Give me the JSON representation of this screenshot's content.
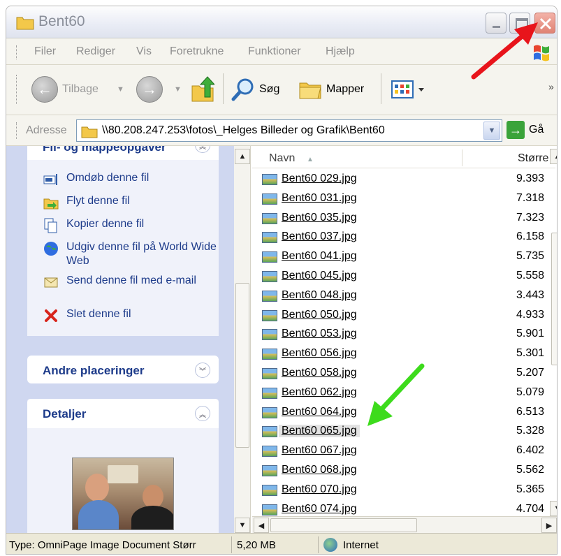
{
  "window": {
    "title": "Bent60"
  },
  "menu": {
    "items": [
      "Filer",
      "Rediger",
      "Vis",
      "Foretrukne",
      "Funktioner",
      "Hjælp"
    ]
  },
  "toolbar": {
    "back_label": "Tilbage",
    "search_label": "Søg",
    "folders_label": "Mapper",
    "more_glyph": "»"
  },
  "address": {
    "label": "Adresse",
    "value": "\\\\80.208.247.253\\fotos\\_Helges Billeder og Grafik\\Bent60",
    "go_label": "Gå"
  },
  "taskpane": {
    "tasks_title": "Fil- og mappeopgaver",
    "tasks": [
      {
        "icon": "rename-icon",
        "label": "Omdøb denne fil"
      },
      {
        "icon": "move-icon",
        "label": "Flyt denne fil"
      },
      {
        "icon": "copy-icon",
        "label": "Kopier denne fil"
      },
      {
        "icon": "publish-web-icon",
        "label": "Udgiv denne fil på World Wide Web"
      },
      {
        "icon": "email-icon",
        "label": "Send denne fil med e-mail"
      },
      {
        "icon": "delete-icon",
        "label": "Slet denne fil"
      }
    ],
    "places_title": "Andre placeringer",
    "details_title": "Detaljer"
  },
  "filelist": {
    "columns": {
      "name": "Navn",
      "size": "Større"
    },
    "files": [
      {
        "name": "Bent60 029.jpg",
        "size": "9.393"
      },
      {
        "name": "Bent60 031.jpg",
        "size": "7.318"
      },
      {
        "name": "Bent60 035.jpg",
        "size": "7.323"
      },
      {
        "name": "Bent60 037.jpg",
        "size": "6.158"
      },
      {
        "name": "Bent60 041.jpg",
        "size": "5.735"
      },
      {
        "name": "Bent60 045.jpg",
        "size": "5.558"
      },
      {
        "name": "Bent60 048.jpg",
        "size": "3.443"
      },
      {
        "name": "Bent60 050.jpg",
        "size": "4.933"
      },
      {
        "name": "Bent60 053.jpg",
        "size": "5.901"
      },
      {
        "name": "Bent60 056.jpg",
        "size": "5.301"
      },
      {
        "name": "Bent60 058.jpg",
        "size": "5.207"
      },
      {
        "name": "Bent60 062.jpg",
        "size": "5.079"
      },
      {
        "name": "Bent60 064.jpg",
        "size": "6.513"
      },
      {
        "name": "Bent60 065.jpg",
        "size": "5.328",
        "selected": true
      },
      {
        "name": "Bent60 067.jpg",
        "size": "6.402"
      },
      {
        "name": "Bent60 068.jpg",
        "size": "5.562"
      },
      {
        "name": "Bent60 070.jpg",
        "size": "5.365"
      },
      {
        "name": "Bent60 074.jpg",
        "size": "4.704"
      }
    ]
  },
  "statusbar": {
    "type_text": "Type: OmniPage Image Document Størr",
    "size_text": "5,20 MB",
    "zone_text": "Internet"
  },
  "colors": {
    "annotation_red": "#e8141b",
    "annotation_green": "#3ddb1c",
    "taskpane_blue": "#1d3b8a"
  }
}
